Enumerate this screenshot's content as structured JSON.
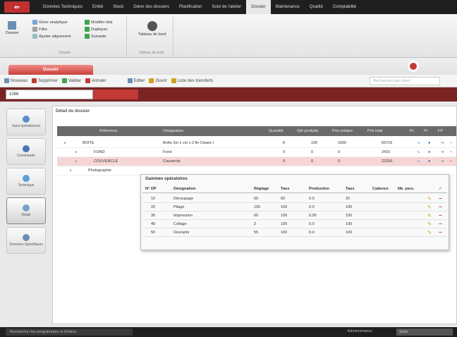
{
  "menu": [
    "Données Techniques",
    "Entité",
    "Stock",
    "Gérer des dossiers",
    "Planification",
    "Suivi de l'atelier",
    "Dossier",
    "Maintenance",
    "Qualité",
    "Comptabilité"
  ],
  "menu_active_index": 6,
  "ribbon": {
    "group1_title": "Dossier",
    "group2_title": "Tableau de bord",
    "big_button": "Dossier",
    "items": [
      "Gérer analytique",
      "Modifier état",
      "Filtre",
      "Dupliquer",
      "Ajuster alignement",
      "Suivante"
    ],
    "tableau_label": "Tableau de bord"
  },
  "doc_tab": "Dossier",
  "toolbar": {
    "buttons": [
      "Nouveau",
      "Supprimer",
      "Valider",
      "Annuler",
      "Editer",
      "Ouvrir",
      "Liste des transferts"
    ],
    "search_placeholder": "Rechercher par client"
  },
  "dossier": {
    "number": "1086"
  },
  "sidebar": [
    {
      "label": "Suivi opérationnel",
      "color": "#5a8ec6"
    },
    {
      "label": "Commande",
      "color": "#4a74b5"
    },
    {
      "label": "Technique",
      "color": "#5aa0d6"
    },
    {
      "label": "Détail",
      "color": "#7a9fc9"
    },
    {
      "label": "Données Spécifiques",
      "color": "#6c8fb3"
    }
  ],
  "main": {
    "title": "Détail du dossier",
    "headers": [
      "Référence",
      "Désignation",
      "Quantité",
      "Qté produite",
      "Prix unitaire",
      "Prix total",
      "PL",
      "PI",
      "FP"
    ],
    "rows": [
      {
        "ref": "BOITE",
        "des": "Boîte 2m x cm x 2 fin Cleare I",
        "qte": "8",
        "qp": "100",
        "pu": "1500",
        "pt": "69716"
      },
      {
        "ref": "FOND",
        "des": "Fond",
        "qte": "0",
        "qp": "0",
        "pu": "0",
        "pt": "2415"
      },
      {
        "ref": "COUVERCLE",
        "des": "Couvercle",
        "qte": "0",
        "qp": "0",
        "pu": "0",
        "pt": "22200"
      },
      {
        "ref": "Photographie",
        "des": "",
        "qte": "",
        "qp": "",
        "pu": "",
        "pt": ""
      }
    ]
  },
  "popup": {
    "title": "Gammes opératoires",
    "headers": [
      "N° OP",
      "Désignation",
      "Réglage",
      "Taux",
      "Production",
      "Taux",
      "Cadence",
      "Nb. pers."
    ],
    "rows": [
      {
        "op": "10",
        "des": "Découpage",
        "reg": "60",
        "t1": "60",
        "prod": "0.0",
        "t2": "20"
      },
      {
        "op": "20",
        "des": "Pliage",
        "reg": "105",
        "t1": "100",
        "prod": "0.0",
        "t2": "100"
      },
      {
        "op": "30",
        "des": "Impression",
        "reg": "60",
        "t1": "100",
        "prod": "0.00",
        "t2": "100"
      },
      {
        "op": "40",
        "des": "Collage",
        "reg": "2",
        "t1": "100",
        "prod": "0.0",
        "t2": "100"
      },
      {
        "op": "50",
        "des": "Ouvrants",
        "reg": "55",
        "t1": "100",
        "prod": "0.0",
        "t2": "100"
      }
    ]
  },
  "status": {
    "left": "Rechercher les programmes et fichiers",
    "user": "Administrateur",
    "date": "Suivi"
  }
}
